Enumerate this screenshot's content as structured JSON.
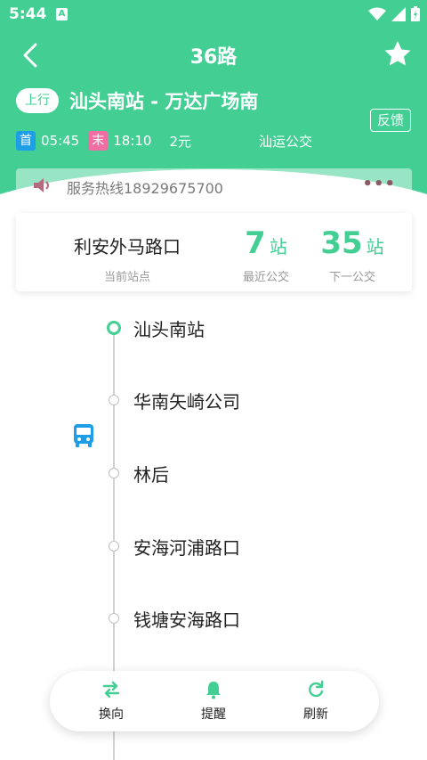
{
  "status_bar": {
    "time": "5:44",
    "notification_icon_letter": "A"
  },
  "header": {
    "title": "36路",
    "back_icon": "chevron-left-icon",
    "favorite_icon": "star-icon"
  },
  "route": {
    "direction_label": "上行",
    "name": "汕头南站 - 万达广场南",
    "first_tag": "首",
    "first_time": "05:45",
    "last_tag": "末",
    "last_time": "18:10",
    "fare": "2元",
    "operator": "汕运公交",
    "feedback_label": "反馈"
  },
  "hotline": {
    "text": "服务热线18929675700",
    "more": "•••"
  },
  "summary": {
    "current_stop": "利安外马路口",
    "current_stop_caption": "当前站点",
    "nearest_count": "7",
    "nearest_unit": "站",
    "nearest_caption": "最近公交",
    "next_count": "35",
    "next_unit": "站",
    "next_caption": "下一公交"
  },
  "stops": [
    "汕头南站",
    "华南矢崎公司",
    "林后",
    "安海河浦路口",
    "钱塘安海路口"
  ],
  "bottom_nav": [
    {
      "label": "换向",
      "icon": "swap-icon"
    },
    {
      "label": "提醒",
      "icon": "bell-icon"
    },
    {
      "label": "刷新",
      "icon": "refresh-icon"
    }
  ],
  "colors": {
    "primary": "#43cf94",
    "first_tag": "#1f9ee8",
    "last_tag": "#f06ea3",
    "bus": "#1f9ee8"
  }
}
